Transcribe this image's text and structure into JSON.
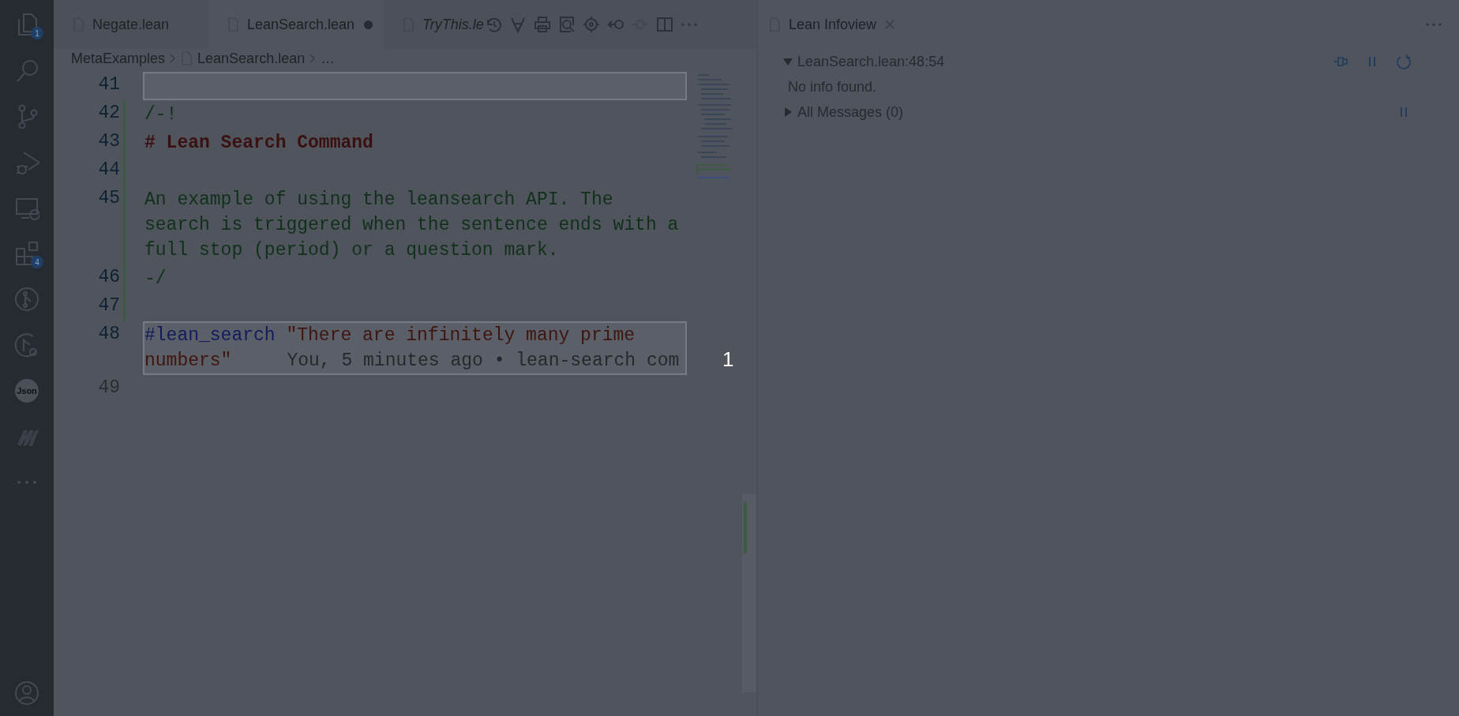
{
  "activity_bar": {
    "items": [
      {
        "kind": "files",
        "badge": "1"
      },
      {
        "kind": "search"
      },
      {
        "kind": "source-control"
      },
      {
        "kind": "debug"
      },
      {
        "kind": "remote"
      },
      {
        "kind": "extensions",
        "badge": "4"
      },
      {
        "kind": "git-graph"
      },
      {
        "kind": "git-search"
      },
      {
        "kind": "json",
        "label": "Json"
      },
      {
        "kind": "logo"
      },
      {
        "kind": "more"
      }
    ],
    "bottom": [
      {
        "kind": "account"
      }
    ]
  },
  "editor": {
    "tabs": [
      {
        "label": "Negate.lean",
        "selected": false,
        "dirty": false,
        "preview": false
      },
      {
        "label": "LeanSearch.lean",
        "selected": true,
        "dirty": true,
        "preview": false
      },
      {
        "label": "TryThis.le",
        "selected": false,
        "dirty": false,
        "preview": true
      }
    ],
    "breadcrumbs": [
      "MetaExamples",
      "LeanSearch.lean",
      "…"
    ],
    "lines": [
      {
        "number": "41",
        "highlighted": true,
        "modified": false,
        "rows": [
          []
        ]
      },
      {
        "number": "42",
        "highlighted": false,
        "modified": true,
        "rows": [
          [
            {
              "kind": "comment",
              "text": "/-!"
            }
          ]
        ]
      },
      {
        "number": "43",
        "highlighted": false,
        "modified": true,
        "rows": [
          [
            {
              "kind": "heading",
              "text": "# Lean Search Command"
            }
          ]
        ]
      },
      {
        "number": "44",
        "highlighted": false,
        "modified": true,
        "rows": [
          []
        ]
      },
      {
        "number": "45",
        "highlighted": false,
        "modified": true,
        "rows": [
          [
            {
              "kind": "comment",
              "text": "An example of using the leansearch API. The"
            }
          ],
          [
            {
              "kind": "comment",
              "text": "search is triggered when the sentence ends with a"
            }
          ],
          [
            {
              "kind": "comment",
              "text": "full stop (period) or a question mark."
            }
          ]
        ]
      },
      {
        "number": "46",
        "highlighted": false,
        "modified": true,
        "rows": [
          [
            {
              "kind": "comment",
              "text": "-/"
            }
          ]
        ]
      },
      {
        "number": "47",
        "highlighted": false,
        "modified": true,
        "rows": [
          []
        ]
      },
      {
        "number": "48",
        "highlighted": true,
        "modified": false,
        "rows": [
          [
            {
              "kind": "keyword",
              "text": "#lean_search"
            },
            {
              "kind": "string",
              "text": " \"There are infinitely many prime"
            }
          ],
          [
            {
              "kind": "string",
              "text": "numbers\""
            },
            {
              "kind": "blame",
              "text": "You, 5 minutes ago • lean-search com"
            }
          ]
        ]
      },
      {
        "number": "49",
        "highlighted": false,
        "modified": false,
        "faded": true,
        "rows": [
          []
        ]
      }
    ]
  },
  "step_number": "1",
  "infoview": {
    "tab": {
      "label": "Lean Infoview"
    },
    "sections": [
      {
        "kind": "goal",
        "title": "LeanSearch.lean:48:54",
        "expanded": true,
        "body": "No info found."
      },
      {
        "kind": "messages",
        "title": "All Messages (0)",
        "expanded": false
      }
    ]
  }
}
